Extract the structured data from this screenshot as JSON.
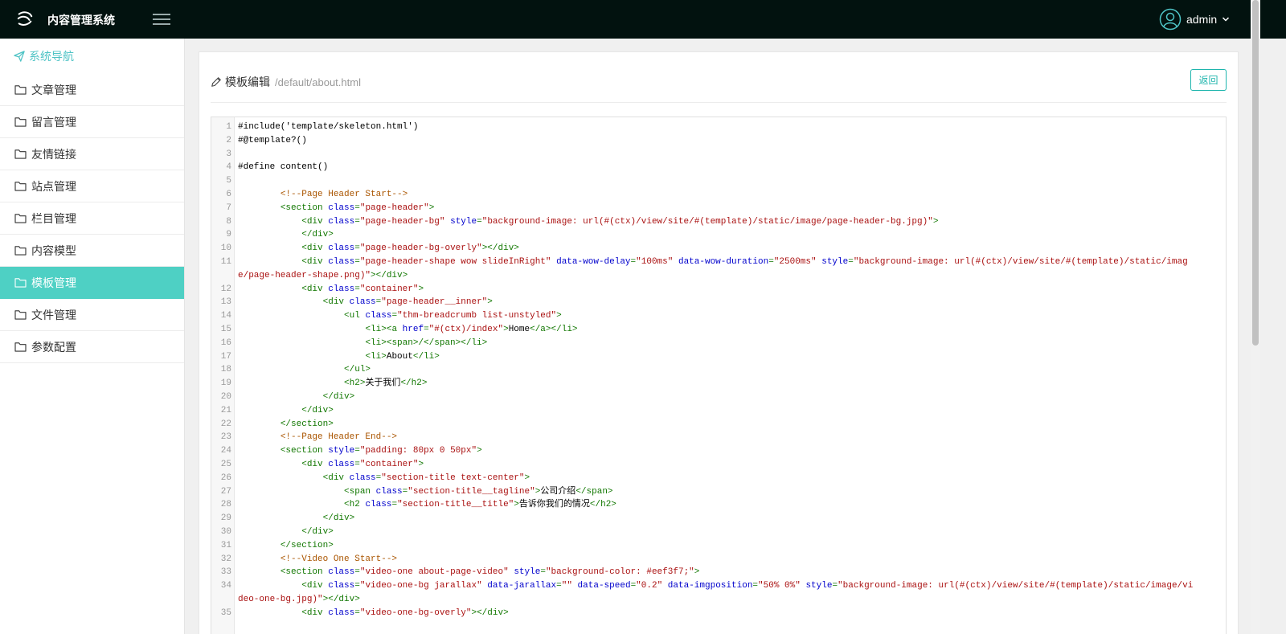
{
  "app": {
    "title": "内容管理系统",
    "user": "admin"
  },
  "colors": {
    "topbar": "#02120f",
    "accent": "#4ed0c4",
    "button": "#1fb5ad"
  },
  "sidebar": {
    "header": "系统导航",
    "items": [
      {
        "label": "文章管理",
        "icon": "folder-icon",
        "active": false
      },
      {
        "label": "留言管理",
        "icon": "folder-icon",
        "active": false
      },
      {
        "label": "友情链接",
        "icon": "folder-icon",
        "active": false
      },
      {
        "label": "站点管理",
        "icon": "folder-icon",
        "active": false
      },
      {
        "label": "栏目管理",
        "icon": "folder-icon",
        "active": false
      },
      {
        "label": "内容模型",
        "icon": "folder-icon",
        "active": false
      },
      {
        "label": "模板管理",
        "icon": "folder-icon",
        "active": true
      },
      {
        "label": "文件管理",
        "icon": "folder-icon",
        "active": false
      },
      {
        "label": "参数配置",
        "icon": "folder-icon",
        "active": false
      }
    ]
  },
  "page": {
    "title": "模板编辑",
    "path": "/default/about.html",
    "back_label": "返回"
  },
  "editor": {
    "lines": [
      {
        "n": "1",
        "tokens": [
          [
            "t-text",
            "#include('template/skeleton.html')"
          ]
        ]
      },
      {
        "n": "2",
        "tokens": [
          [
            "t-text",
            "#@template?()"
          ]
        ]
      },
      {
        "n": "3",
        "tokens": []
      },
      {
        "n": "4",
        "tokens": [
          [
            "t-text",
            "#define content()"
          ]
        ]
      },
      {
        "n": "5",
        "tokens": []
      },
      {
        "n": "6",
        "tokens": [
          [
            "t-text",
            "        "
          ],
          [
            "t-com",
            "<!--Page Header Start-->"
          ]
        ]
      },
      {
        "n": "7",
        "tokens": [
          [
            "t-text",
            "        "
          ],
          [
            "t-tag",
            "<section "
          ],
          [
            "t-attr",
            "class"
          ],
          [
            "t-tag",
            "="
          ],
          [
            "t-str",
            "\"page-header\""
          ],
          [
            "t-tag",
            ">"
          ]
        ]
      },
      {
        "n": "8",
        "tokens": [
          [
            "t-text",
            "            "
          ],
          [
            "t-tag",
            "<div "
          ],
          [
            "t-attr",
            "class"
          ],
          [
            "t-tag",
            "="
          ],
          [
            "t-str",
            "\"page-header-bg\""
          ],
          [
            "t-text",
            " "
          ],
          [
            "t-attr",
            "style"
          ],
          [
            "t-tag",
            "="
          ],
          [
            "t-str",
            "\"background-image: url(#(ctx)/view/site/#(template)/static/image/page-header-bg.jpg)\""
          ],
          [
            "t-tag",
            ">"
          ]
        ]
      },
      {
        "n": "9",
        "tokens": [
          [
            "t-text",
            "            "
          ],
          [
            "t-tag",
            "</div>"
          ]
        ]
      },
      {
        "n": "10",
        "tokens": [
          [
            "t-text",
            "            "
          ],
          [
            "t-tag",
            "<div "
          ],
          [
            "t-attr",
            "class"
          ],
          [
            "t-tag",
            "="
          ],
          [
            "t-str",
            "\"page-header-bg-overly\""
          ],
          [
            "t-tag",
            "></div>"
          ]
        ]
      },
      {
        "n": "11",
        "tokens": [
          [
            "t-text",
            "            "
          ],
          [
            "t-tag",
            "<div "
          ],
          [
            "t-attr",
            "class"
          ],
          [
            "t-tag",
            "="
          ],
          [
            "t-str",
            "\"page-header-shape wow slideInRight\""
          ],
          [
            "t-text",
            " "
          ],
          [
            "t-attr",
            "data-wow-delay"
          ],
          [
            "t-tag",
            "="
          ],
          [
            "t-str",
            "\"100ms\""
          ],
          [
            "t-text",
            " "
          ],
          [
            "t-attr",
            "data-wow-duration"
          ],
          [
            "t-tag",
            "="
          ],
          [
            "t-str",
            "\"2500ms\""
          ],
          [
            "t-text",
            " "
          ],
          [
            "t-attr",
            "style"
          ],
          [
            "t-tag",
            "="
          ],
          [
            "t-str",
            "\"background-image: url(#(ctx)/view/site/#(template)/static/image/page-header-shape.png)\""
          ],
          [
            "t-tag",
            "></div>"
          ]
        ]
      },
      {
        "n": "12",
        "tokens": [
          [
            "t-text",
            "            "
          ],
          [
            "t-tag",
            "<div "
          ],
          [
            "t-attr",
            "class"
          ],
          [
            "t-tag",
            "="
          ],
          [
            "t-str",
            "\"container\""
          ],
          [
            "t-tag",
            ">"
          ]
        ]
      },
      {
        "n": "13",
        "tokens": [
          [
            "t-text",
            "                "
          ],
          [
            "t-tag",
            "<div "
          ],
          [
            "t-attr",
            "class"
          ],
          [
            "t-tag",
            "="
          ],
          [
            "t-str",
            "\"page-header__inner\""
          ],
          [
            "t-tag",
            ">"
          ]
        ]
      },
      {
        "n": "14",
        "tokens": [
          [
            "t-text",
            "                    "
          ],
          [
            "t-tag",
            "<ul "
          ],
          [
            "t-attr",
            "class"
          ],
          [
            "t-tag",
            "="
          ],
          [
            "t-str",
            "\"thm-breadcrumb list-unstyled\""
          ],
          [
            "t-tag",
            ">"
          ]
        ]
      },
      {
        "n": "15",
        "tokens": [
          [
            "t-text",
            "                        "
          ],
          [
            "t-tag",
            "<li><a "
          ],
          [
            "t-attr",
            "href"
          ],
          [
            "t-tag",
            "="
          ],
          [
            "t-str",
            "\"#(ctx)/index\""
          ],
          [
            "t-tag",
            ">"
          ],
          [
            "t-text",
            "Home"
          ],
          [
            "t-tag",
            "</a></li>"
          ]
        ]
      },
      {
        "n": "16",
        "tokens": [
          [
            "t-text",
            "                        "
          ],
          [
            "t-tag",
            "<li><span>/</span></li>"
          ]
        ]
      },
      {
        "n": "17",
        "tokens": [
          [
            "t-text",
            "                        "
          ],
          [
            "t-tag",
            "<li>"
          ],
          [
            "t-text",
            "About"
          ],
          [
            "t-tag",
            "</li>"
          ]
        ]
      },
      {
        "n": "18",
        "tokens": [
          [
            "t-text",
            "                    "
          ],
          [
            "t-tag",
            "</ul>"
          ]
        ]
      },
      {
        "n": "19",
        "tokens": [
          [
            "t-text",
            "                    "
          ],
          [
            "t-tag",
            "<h2>"
          ],
          [
            "t-text",
            "关于我们"
          ],
          [
            "t-tag",
            "</h2>"
          ]
        ]
      },
      {
        "n": "20",
        "tokens": [
          [
            "t-text",
            "                "
          ],
          [
            "t-tag",
            "</div>"
          ]
        ]
      },
      {
        "n": "21",
        "tokens": [
          [
            "t-text",
            "            "
          ],
          [
            "t-tag",
            "</div>"
          ]
        ]
      },
      {
        "n": "22",
        "tokens": [
          [
            "t-text",
            "        "
          ],
          [
            "t-tag",
            "</section>"
          ]
        ]
      },
      {
        "n": "23",
        "tokens": [
          [
            "t-text",
            "        "
          ],
          [
            "t-com",
            "<!--Page Header End-->"
          ]
        ]
      },
      {
        "n": "24",
        "tokens": [
          [
            "t-text",
            "        "
          ],
          [
            "t-tag",
            "<section "
          ],
          [
            "t-attr",
            "style"
          ],
          [
            "t-tag",
            "="
          ],
          [
            "t-str",
            "\"padding: 80px 0 50px\""
          ],
          [
            "t-tag",
            ">"
          ]
        ]
      },
      {
        "n": "25",
        "tokens": [
          [
            "t-text",
            "            "
          ],
          [
            "t-tag",
            "<div "
          ],
          [
            "t-attr",
            "class"
          ],
          [
            "t-tag",
            "="
          ],
          [
            "t-str",
            "\"container\""
          ],
          [
            "t-tag",
            ">"
          ]
        ]
      },
      {
        "n": "26",
        "tokens": [
          [
            "t-text",
            "                "
          ],
          [
            "t-tag",
            "<div "
          ],
          [
            "t-attr",
            "class"
          ],
          [
            "t-tag",
            "="
          ],
          [
            "t-str",
            "\"section-title text-center\""
          ],
          [
            "t-tag",
            ">"
          ]
        ]
      },
      {
        "n": "27",
        "tokens": [
          [
            "t-text",
            "                    "
          ],
          [
            "t-tag",
            "<span "
          ],
          [
            "t-attr",
            "class"
          ],
          [
            "t-tag",
            "="
          ],
          [
            "t-str",
            "\"section-title__tagline\""
          ],
          [
            "t-tag",
            ">"
          ],
          [
            "t-text",
            "公司介绍"
          ],
          [
            "t-tag",
            "</span>"
          ]
        ]
      },
      {
        "n": "28",
        "tokens": [
          [
            "t-text",
            "                    "
          ],
          [
            "t-tag",
            "<h2 "
          ],
          [
            "t-attr",
            "class"
          ],
          [
            "t-tag",
            "="
          ],
          [
            "t-str",
            "\"section-title__title\""
          ],
          [
            "t-tag",
            ">"
          ],
          [
            "t-text",
            "告诉你我们的情况"
          ],
          [
            "t-tag",
            "</h2>"
          ]
        ]
      },
      {
        "n": "29",
        "tokens": [
          [
            "t-text",
            "                "
          ],
          [
            "t-tag",
            "</div>"
          ]
        ]
      },
      {
        "n": "30",
        "tokens": [
          [
            "t-text",
            "            "
          ],
          [
            "t-tag",
            "</div>"
          ]
        ]
      },
      {
        "n": "31",
        "tokens": [
          [
            "t-text",
            "        "
          ],
          [
            "t-tag",
            "</section>"
          ]
        ]
      },
      {
        "n": "32",
        "tokens": [
          [
            "t-text",
            "        "
          ],
          [
            "t-com",
            "<!--Video One Start-->"
          ]
        ]
      },
      {
        "n": "33",
        "tokens": [
          [
            "t-text",
            "        "
          ],
          [
            "t-tag",
            "<section "
          ],
          [
            "t-attr",
            "class"
          ],
          [
            "t-tag",
            "="
          ],
          [
            "t-str",
            "\"video-one about-page-video\""
          ],
          [
            "t-text",
            " "
          ],
          [
            "t-attr",
            "style"
          ],
          [
            "t-tag",
            "="
          ],
          [
            "t-str",
            "\"background-color: #eef3f7;\""
          ],
          [
            "t-tag",
            ">"
          ]
        ]
      },
      {
        "n": "34",
        "tokens": [
          [
            "t-text",
            "            "
          ],
          [
            "t-tag",
            "<div "
          ],
          [
            "t-attr",
            "class"
          ],
          [
            "t-tag",
            "="
          ],
          [
            "t-str",
            "\"video-one-bg jarallax\""
          ],
          [
            "t-text",
            " "
          ],
          [
            "t-attr",
            "data-jarallax"
          ],
          [
            "t-tag",
            "="
          ],
          [
            "t-str",
            "\"\""
          ],
          [
            "t-text",
            " "
          ],
          [
            "t-attr",
            "data-speed"
          ],
          [
            "t-tag",
            "="
          ],
          [
            "t-str",
            "\"0.2\""
          ],
          [
            "t-text",
            " "
          ],
          [
            "t-attr",
            "data-imgposition"
          ],
          [
            "t-tag",
            "="
          ],
          [
            "t-str",
            "\"50% 0%\""
          ],
          [
            "t-text",
            " "
          ],
          [
            "t-attr",
            "style"
          ],
          [
            "t-tag",
            "="
          ],
          [
            "t-str",
            "\"background-image: url(#(ctx)/view/site/#(template)/static/image/video-one-bg.jpg)\""
          ],
          [
            "t-tag",
            "></div>"
          ]
        ]
      },
      {
        "n": "35",
        "tokens": [
          [
            "t-text",
            "            "
          ],
          [
            "t-tag",
            "<div "
          ],
          [
            "t-attr",
            "class"
          ],
          [
            "t-tag",
            "="
          ],
          [
            "t-str",
            "\"video-one-bg-overly\""
          ],
          [
            "t-tag",
            "></div>"
          ]
        ]
      }
    ]
  }
}
